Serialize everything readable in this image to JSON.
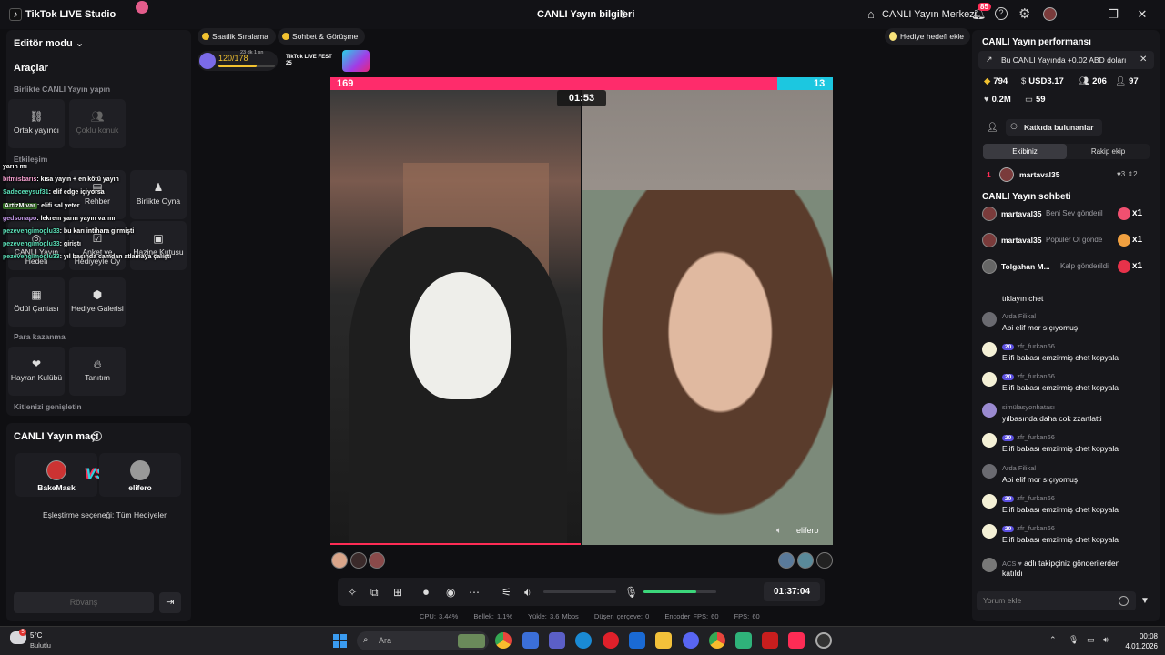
{
  "titlebar": {
    "app_name": "TikTok LIVE Studio",
    "live_info": "CANLI Yayın bilgileri",
    "live_center": "CANLI Yayın Merkezi",
    "notif_count": "85"
  },
  "left": {
    "editor_mode": "Editör modu",
    "tools_heading": "Araçlar",
    "collab_section": "Birlikte CANLI Yayın yapın",
    "tools_collab": [
      {
        "label": "Ortak yayıncı"
      },
      {
        "label": "Çoklu konuk"
      }
    ],
    "interaction_section": "Etkileşim",
    "tools_interaction": [
      {
        "label": "Rehber"
      },
      {
        "label": "Birlikte Oyna"
      },
      {
        "label": "CANLI Yayın Hedefi"
      },
      {
        "label": "Anket ve Hediyeyle Oy"
      },
      {
        "label": "Hazine Kutusu"
      },
      {
        "label": "Ödül Çantası"
      },
      {
        "label": "Hediye Galerisi"
      }
    ],
    "monetize_section": "Para kazanma",
    "tools_monetize": [
      {
        "label": "Hayran Kulübü"
      },
      {
        "label": "Tanıtım"
      }
    ],
    "audience_section": "Kitlenizi genişletin"
  },
  "overlay_chat": [
    {
      "user": "yarın mı",
      "text": "",
      "color": "#ffffff"
    },
    {
      "user": "bitmisbarıs",
      "text": ": kısa yayın + en kötü yayın",
      "color": "#f6a0d0"
    },
    {
      "user": "Sadeceeysuf31",
      "text": ": elif edge içiyorsa",
      "color": "#5be0b8"
    },
    {
      "user": "ArtizMivar",
      "text": ": elifi sal yeter",
      "color": "#9be05b"
    },
    {
      "user": "gedsonapo",
      "text": ": lekrem yarın yayın varmı",
      "color": "#c99bf0"
    },
    {
      "user": "pezevengimoglu33",
      "text": ": bu karı intihara girmişti",
      "color": "#5be0b8"
    },
    {
      "user": "pezevengimoglu33",
      "text": ": giriştı",
      "color": "#5be0b8"
    },
    {
      "user": "pezevengimoglu33",
      "text": ": yıl başında camdan atlamaya çalıştı",
      "color": "#5be0b8"
    }
  ],
  "match": {
    "title": "CANLI Yayın maçı",
    "host_name": "BakeMask",
    "opponent_name": "elifero",
    "match_option": "Eşleştirme seçeneği: Tüm Hediyeler",
    "rematch_label": "Rövanş"
  },
  "stream": {
    "pill_hourly": "Saatlik Sıralama",
    "pill_chat": "Sohbet & Görüşme",
    "rank_progress": "120/178",
    "rank_fraction": 0.67,
    "rank_small": "23 dk 1 sn",
    "fest_label": "TikTok LIVE FEST 25",
    "score_left": "169",
    "score_right": "13",
    "pk_timer": "01:53",
    "opponent_label": "elifero",
    "gift_goal": "Hediye hedefi ekle",
    "elapsed": "01:37:04",
    "mic_level": 0.72,
    "stats": {
      "cpu": "CPU: 3.44%",
      "memory": "Bellek: 1.1%",
      "upload": "Yükle: 3.6 Mbps",
      "dropped": "Düşen çerçeve: 0",
      "encoder": "Encoder FPS: 60",
      "fps": "FPS: 60"
    }
  },
  "right": {
    "perf_title": "CANLI Yayın performansı",
    "earnings_note": "Bu CANLI Yayında +0.02 ABD doları",
    "metrics": {
      "coins": "794",
      "usd": "USD3.17",
      "viewers": "206",
      "likes": "97",
      "views": "0.2M",
      "comments": "59"
    },
    "contributors_btn": "Katkıda bulunanlar",
    "tab_team": "Ekibiniz",
    "tab_rival": "Rakip ekip",
    "top_contributor": {
      "rank": "1",
      "name": "martaval35",
      "stats": "♥3 ⇞2"
    },
    "chat_title": "CANLI Yayın sohbeti",
    "gifts": [
      {
        "name": "martaval35",
        "msg": "Beni Sev gönderil",
        "count": "x1",
        "color": "#f05070"
      },
      {
        "name": "martaval35",
        "msg": "Popüler Ol gönde",
        "count": "x1",
        "color": "#f0a040"
      },
      {
        "name": "Tolgahan M...",
        "msg": "Kalp gönderildi",
        "count": "x1",
        "color": "#e8324a"
      }
    ],
    "messages": [
      {
        "user": "",
        "text": "tıklayın chet",
        "level": "",
        "avatar": "#555"
      },
      {
        "user": "Arda Filikal",
        "text": "Abi elif mor sıçıyomuş",
        "level": "",
        "avatar": "#6a6a70"
      },
      {
        "user": "zfr_furkan66",
        "text": "Elifi babası emzirmiş chet kopyala",
        "level": "20",
        "avatar": "#f4f0d6"
      },
      {
        "user": "zfr_furkan66",
        "text": "Elifi babası emzirmiş chet kopyala",
        "level": "20",
        "avatar": "#f4f0d6"
      },
      {
        "user": "simülasyonhatası",
        "text": "yılbasında daha cok zzartlatti",
        "level": "",
        "avatar": "#9a8ad0"
      },
      {
        "user": "zfr_furkan66",
        "text": "Elifi babası emzirmiş chet kopyala",
        "level": "20",
        "avatar": "#f4f0d6"
      },
      {
        "user": "Arda Filikal",
        "text": "Abi elif mor sıçıyomuş",
        "level": "",
        "avatar": "#6a6a70"
      },
      {
        "user": "zfr_furkan66",
        "text": "Elifi babası emzirmiş chet kopyala",
        "level": "20",
        "avatar": "#f4f0d6"
      },
      {
        "user": "zfr_furkan66",
        "text": "Elifi babası emzirmiş chet kopyala",
        "level": "20",
        "avatar": "#f4f0d6"
      }
    ],
    "follow_user": "ACS",
    "follow_msg": "adlı takipçiniz gönderilerden",
    "follow_msg2": "katıldı",
    "comment_placeholder": "Yorum ekle"
  },
  "taskbar": {
    "weather_temp": "5°C",
    "weather_cond": "Bulutlu",
    "weather_badge": "5",
    "search_placeholder": "Ara",
    "time": "00:08",
    "date": "4.01.2026"
  },
  "colors": {
    "accent": "#fe2c55",
    "cyan": "#1cc7e0",
    "mic_green": "#3bd67a"
  }
}
